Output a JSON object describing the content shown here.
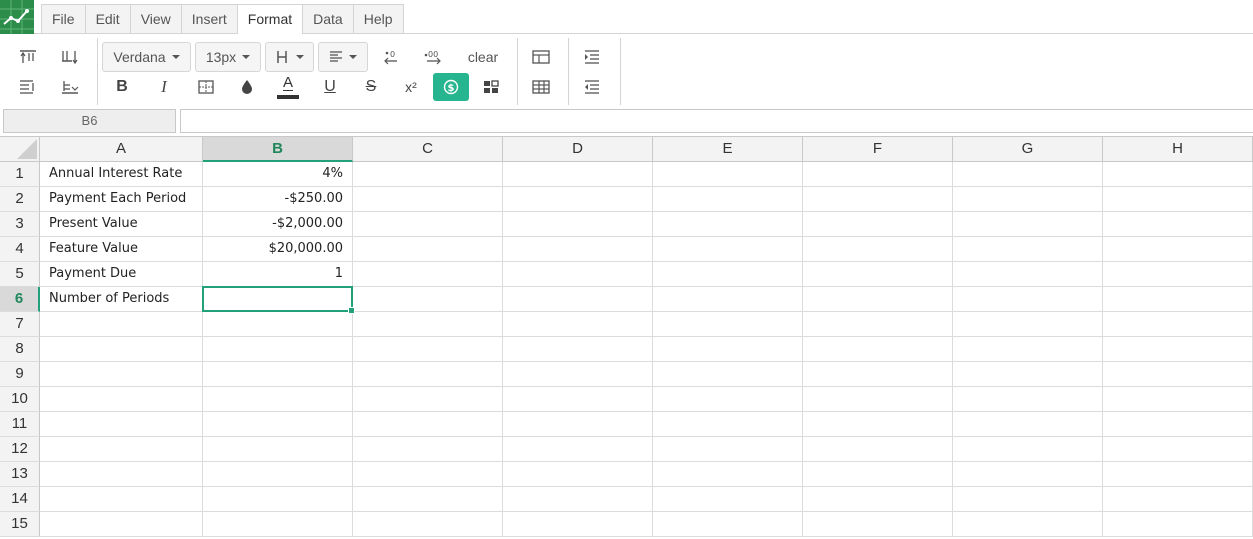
{
  "menu": {
    "items": [
      {
        "label": "File"
      },
      {
        "label": "Edit"
      },
      {
        "label": "View"
      },
      {
        "label": "Insert"
      },
      {
        "label": "Format",
        "active": true
      },
      {
        "label": "Data"
      },
      {
        "label": "Help"
      }
    ]
  },
  "toolbar": {
    "font_family": "Verdana",
    "font_size": "13px",
    "clear_label": "clear",
    "bold_label": "B",
    "italic_label": "I",
    "underline_label": "U",
    "strike_label": "S",
    "superscript_label": "x²",
    "font_color_label": "A",
    "accent_color": "#26b58f"
  },
  "formula_bar": {
    "cell_ref": "B6",
    "value": ""
  },
  "sheet": {
    "columns": [
      "A",
      "B",
      "C",
      "D",
      "E",
      "F",
      "G",
      "H"
    ],
    "selected_column": "B",
    "rows": [
      "1",
      "2",
      "3",
      "4",
      "5",
      "6",
      "7",
      "8",
      "9",
      "10",
      "11",
      "12",
      "13",
      "14",
      "15"
    ],
    "selected_row": "6",
    "cells": {
      "A1": "Annual Interest Rate",
      "B1": "4%",
      "A2": "Payment Each Period",
      "B2": "-$250.00",
      "A3": "Present Value",
      "B3": "-$2,000.00",
      "A4": "Feature Value",
      "B4": "$20,000.00",
      "A5": "Payment Due",
      "B5": "1",
      "A6": "Number of Periods",
      "B6": ""
    },
    "selection_color": "#21a07a"
  }
}
